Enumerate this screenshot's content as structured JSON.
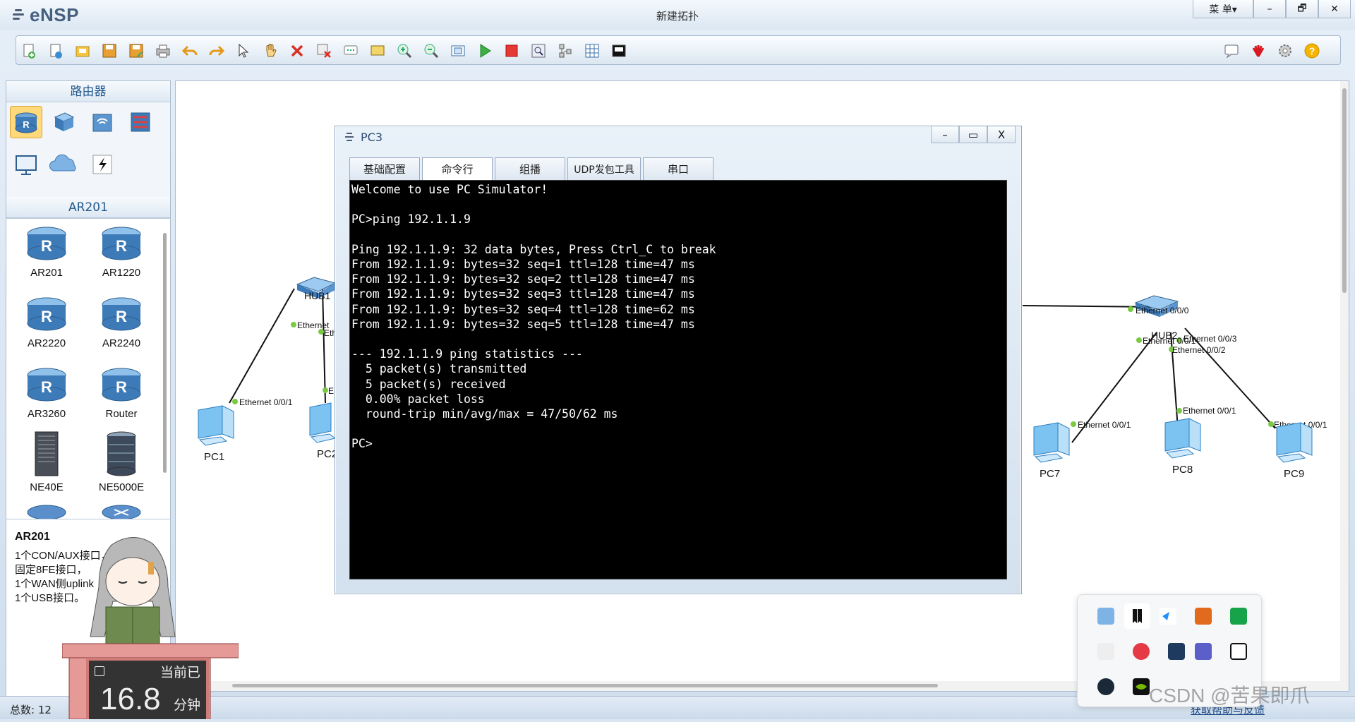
{
  "app": {
    "logo": "eNSP",
    "title": "新建拓扑",
    "menu_label": "菜 单▾",
    "minimize": "–",
    "restore": "🗗",
    "close": "✕"
  },
  "toolbar": {
    "icons": [
      "new-topology-icon",
      "new-from-template-icon",
      "open-icon",
      "save-icon",
      "save-as-icon",
      "print-icon",
      "undo-icon",
      "redo-icon",
      "select-icon",
      "pan-icon",
      "delete-icon",
      "delete-link-icon",
      "text-icon",
      "palette-icon",
      "zoom-in-icon",
      "zoom-out-icon",
      "fit-icon",
      "start-icon",
      "stop-icon",
      "capture-icon",
      "topology-icon",
      "grid-icon",
      "screenshot-icon"
    ],
    "right_icons": [
      "message-icon",
      "huawei-icon",
      "settings-icon",
      "help-icon"
    ]
  },
  "left_panel": {
    "category_title": "路由器",
    "device_section_title": "AR201",
    "devices": [
      "AR201",
      "AR1220",
      "AR2220",
      "AR2240",
      "AR3260",
      "Router",
      "NE40E",
      "NE5000E"
    ],
    "desc_title": "AR201",
    "desc_lines": [
      "1个CON/AUX接口，",
      "固定8FE接口，",
      "1个WAN侧uplink",
      "1个USB接口。"
    ]
  },
  "canvas": {
    "labels": {
      "hub1": "HUB1",
      "hub2": "HUB2",
      "pc1": "PC1",
      "pc2": "PC2",
      "pc7": "PC7",
      "pc8": "PC8",
      "pc9": "PC9",
      "pc1_if": "Ethernet 0/0/1",
      "hub1_if_a": "Ethernet",
      "hub1_if_b": "Eth",
      "pc2_if": "E",
      "hub2_if0": "Ethernet 0/0/0",
      "hub2_if1": "Ethernet 0/0/1",
      "hub2_if2": "Ethernet 0/0/2",
      "hub2_if3": "Ethernet 0/0/3",
      "pc7_if": "Ethernet 0/0/1",
      "pc8_if": "Ethernet 0/0/1",
      "pc9_if": "Ethernet 0/0/1"
    }
  },
  "dialog": {
    "title": "PC3",
    "tabs": [
      "基础配置",
      "命令行",
      "组播",
      "UDP发包工具",
      "串口"
    ],
    "active_tab": "命令行",
    "terminal": "Welcome to use PC Simulator!\n\nPC>ping 192.1.1.9\n\nPing 192.1.1.9: 32 data bytes, Press Ctrl_C to break\nFrom 192.1.1.9: bytes=32 seq=1 ttl=128 time=47 ms\nFrom 192.1.1.9: bytes=32 seq=2 ttl=128 time=47 ms\nFrom 192.1.1.9: bytes=32 seq=3 ttl=128 time=47 ms\nFrom 192.1.1.9: bytes=32 seq=4 ttl=128 time=62 ms\nFrom 192.1.1.9: bytes=32 seq=5 ttl=128 time=47 ms\n\n--- 192.1.1.9 ping statistics ---\n  5 packet(s) transmitted\n  5 packet(s) received\n  0.00% packet loss\n  round-trip min/avg/max = 47/50/62 ms\n\nPC>"
  },
  "status": {
    "total": "总数: 12",
    "help": "获取帮助与反馈"
  },
  "timer": {
    "label": "当前已",
    "value": "16.8",
    "unit": "分钟"
  },
  "watermark": "CSDN @苦果即爪",
  "colors": {
    "accent": "#245a8e",
    "link": "#1f4d8a",
    "port": "#7ac943"
  }
}
